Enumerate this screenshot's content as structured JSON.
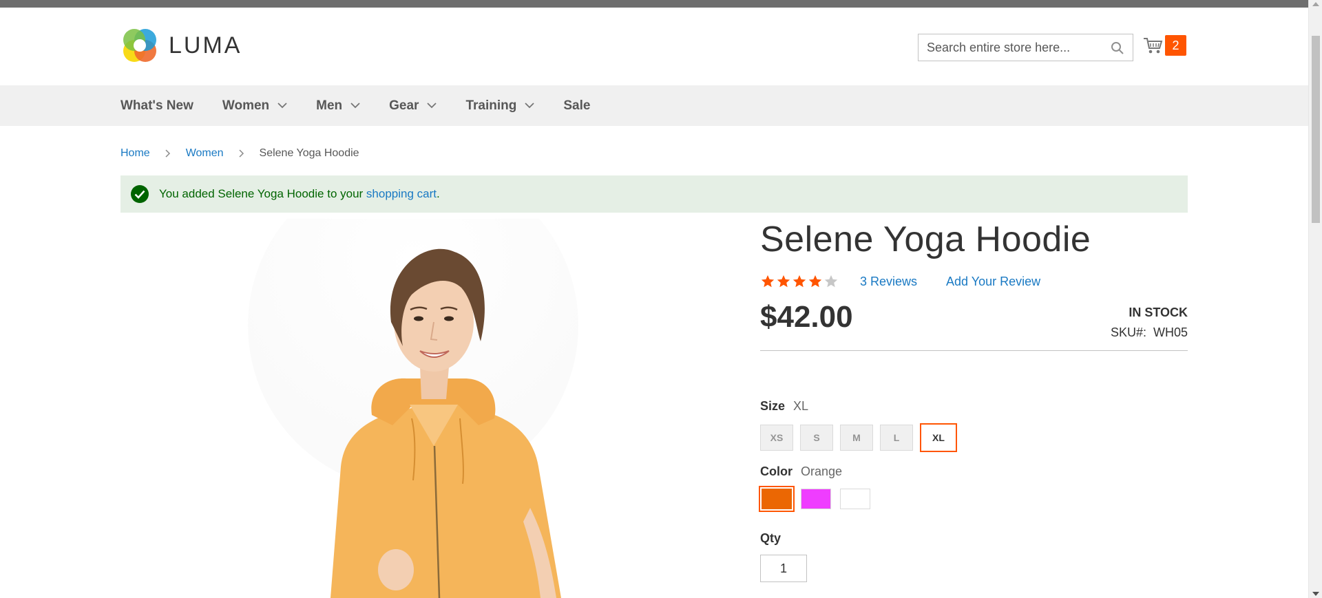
{
  "header": {
    "logo_text": "LUMA",
    "search": {
      "placeholder": "Search entire store here...",
      "value": ""
    },
    "cart": {
      "count": "2"
    }
  },
  "nav": {
    "items": [
      {
        "label": "What's New",
        "has_dropdown": false
      },
      {
        "label": "Women",
        "has_dropdown": true
      },
      {
        "label": "Men",
        "has_dropdown": true
      },
      {
        "label": "Gear",
        "has_dropdown": true
      },
      {
        "label": "Training",
        "has_dropdown": true
      },
      {
        "label": "Sale",
        "has_dropdown": false
      }
    ]
  },
  "breadcrumb": {
    "items": [
      {
        "label": "Home"
      },
      {
        "label": "Women"
      },
      {
        "label": "Selene Yoga Hoodie"
      }
    ]
  },
  "message": {
    "prefix": "You added Selene Yoga Hoodie to your ",
    "link": "shopping cart",
    "suffix": "."
  },
  "product": {
    "name": "Selene Yoga Hoodie",
    "rating": {
      "stars": 4,
      "max": 5
    },
    "reviews_label": "3  Reviews",
    "add_review_label": "Add Your Review",
    "price": "$42.00",
    "stock": "IN STOCK",
    "sku_label": "SKU#:",
    "sku_value": "WH05",
    "size": {
      "label": "Size",
      "selected": "XL",
      "options": [
        "XS",
        "S",
        "M",
        "L",
        "XL"
      ]
    },
    "color": {
      "label": "Color",
      "selected": "Orange",
      "options": [
        {
          "name": "Orange",
          "hex": "#eb6703"
        },
        {
          "name": "Purple",
          "hex": "#ef3dff"
        },
        {
          "name": "White",
          "hex": "#ffffff"
        }
      ]
    },
    "qty": {
      "label": "Qty",
      "value": "1"
    }
  },
  "colors": {
    "accent": "#ff5501",
    "link": "#1979c3",
    "success_bg": "#e5efe5",
    "success_text": "#006400"
  }
}
